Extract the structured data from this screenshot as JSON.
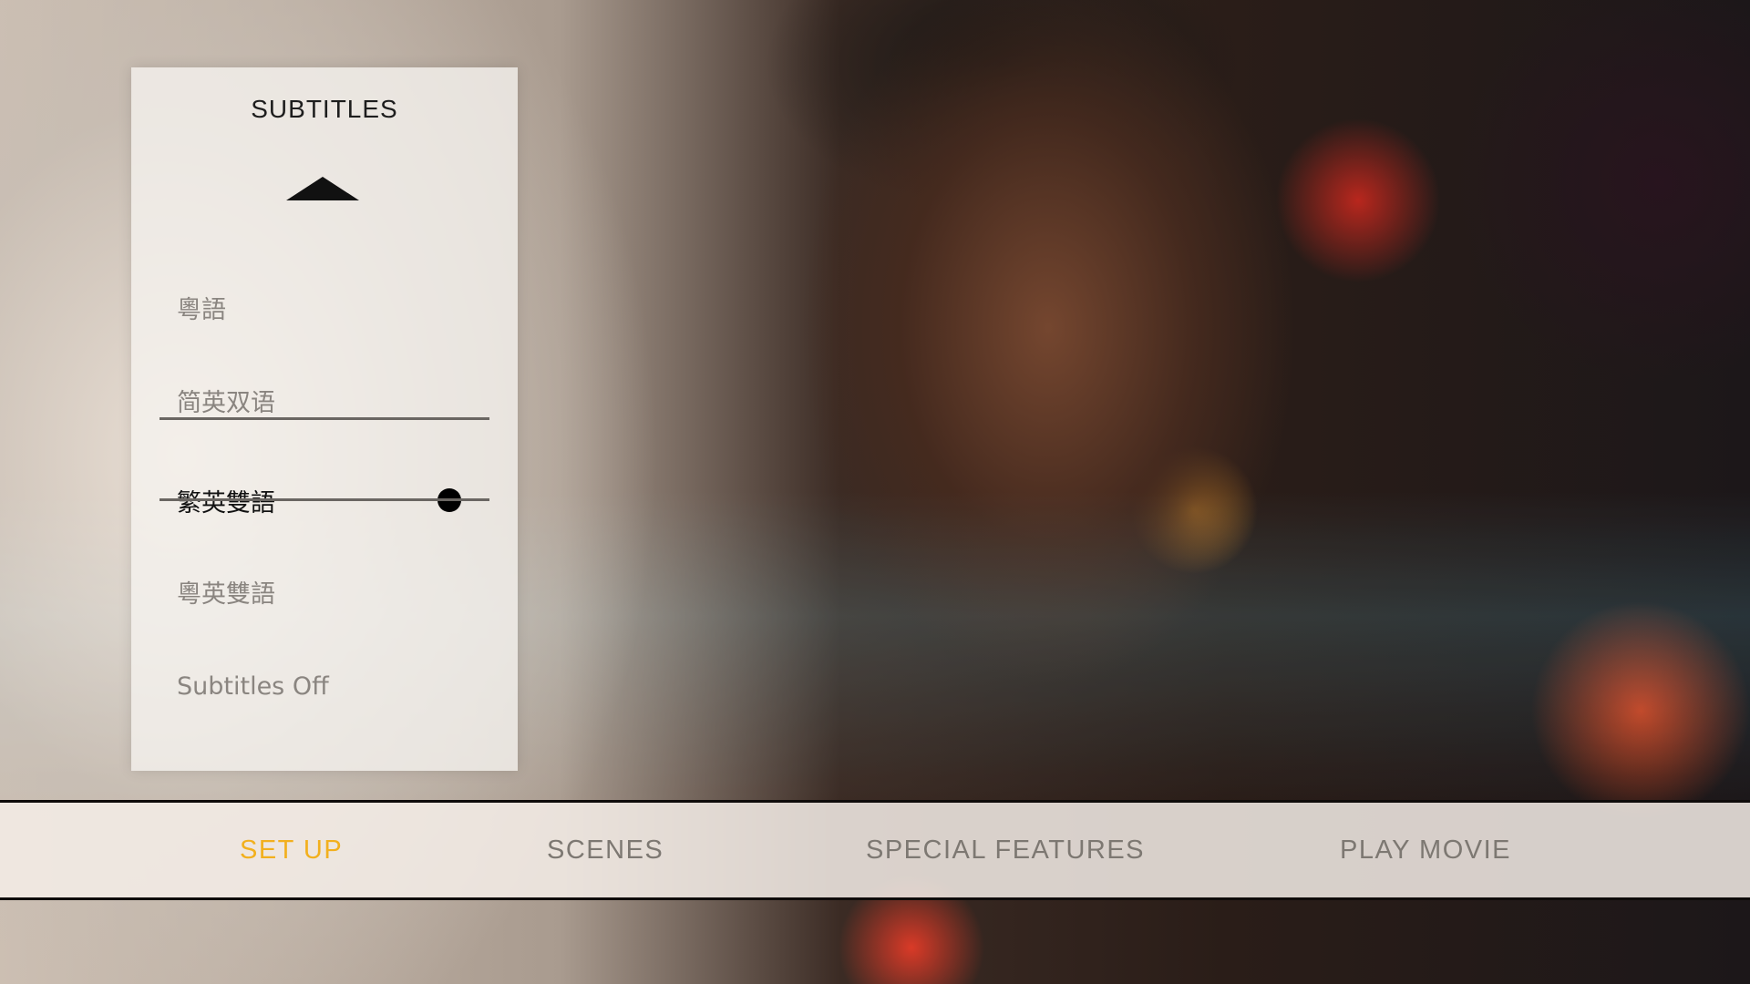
{
  "panel": {
    "title": "SUBTITLES",
    "options": [
      {
        "label": "粵語",
        "selected": false
      },
      {
        "label": "简英双语",
        "selected": false
      },
      {
        "label": "繁英雙語",
        "selected": true
      },
      {
        "label": "粵英雙語",
        "selected": false
      },
      {
        "label": "Subtitles Off",
        "selected": false
      }
    ],
    "icons": {
      "scroll_up": "triangle-up-icon",
      "selected_marker": "filled-circle-icon"
    }
  },
  "nav": {
    "items": [
      {
        "label": "SET UP",
        "active": true
      },
      {
        "label": "SCENES",
        "active": false
      },
      {
        "label": "SPECIAL FEATURES",
        "active": false
      },
      {
        "label": "PLAY MOVIE",
        "active": false
      }
    ]
  },
  "colors": {
    "active_nav": "#f2b01e",
    "inactive_text": "#7d7872",
    "selected_text": "#111111"
  }
}
